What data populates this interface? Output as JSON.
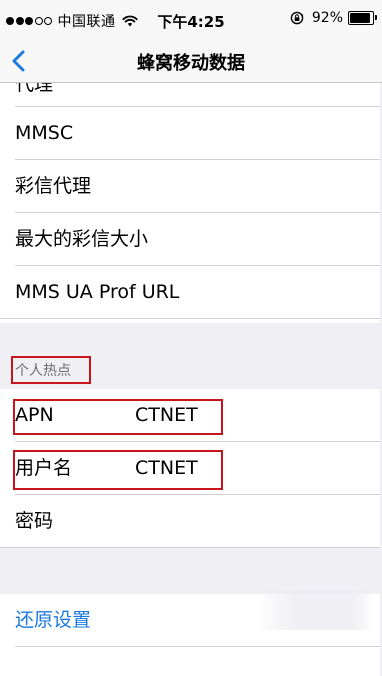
{
  "status_bar": {
    "signal_icon": "signal-dots-icon",
    "carrier": "中国联通",
    "wifi_icon": "wifi-icon",
    "time": "下午4:25",
    "rotation_lock_icon": "rotation-lock-icon",
    "battery_percent": "92%",
    "battery_level": 0.92
  },
  "nav": {
    "back_icon": "chevron-left-icon",
    "title": "蜂窝移动数据"
  },
  "top_group": {
    "partial_label": "代理",
    "rows": [
      {
        "label": "MMSC"
      },
      {
        "label": "彩信代理"
      },
      {
        "label": "最大的彩信大小"
      },
      {
        "label": "MMS UA Prof URL"
      }
    ]
  },
  "hotspot_section": {
    "header": "个人热点",
    "rows": [
      {
        "label": "APN",
        "value": "CTNET"
      },
      {
        "label": "用户名",
        "value": "CTNET"
      },
      {
        "label": "密码",
        "value": ""
      }
    ]
  },
  "reset": {
    "label": "还原设置"
  },
  "colors": {
    "accent": "#1a7ae0",
    "highlight_box": "#c8151b",
    "group_background": "#efeff4"
  }
}
